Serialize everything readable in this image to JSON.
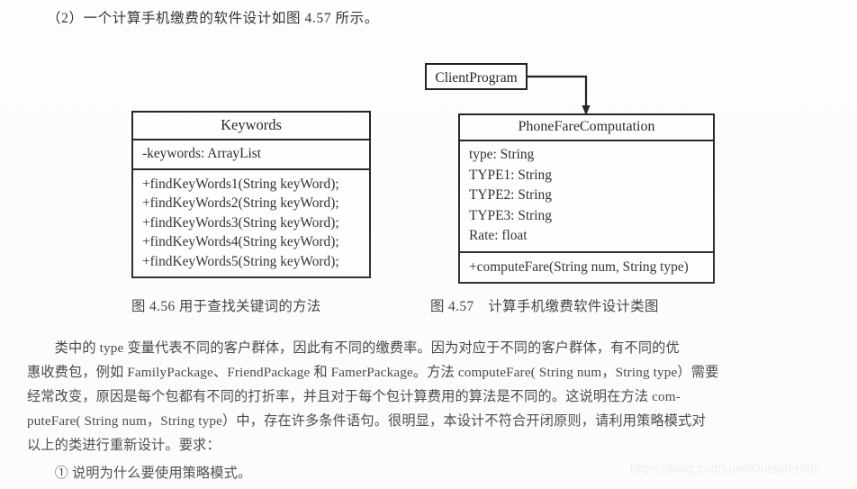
{
  "page": {
    "intro_text": "（2）一个计算手机缴费的软件设计如图 4.57 所示。",
    "watermark": "https://blog.csdn.net/Outsider98k"
  },
  "diagrams": {
    "keywords_class": {
      "name": "Keywords",
      "attributes": [
        "-keywords: ArrayList"
      ],
      "operations": [
        "+findKeyWords1(String keyWord);",
        "+findKeyWords2(String keyWord);",
        "+findKeyWords3(String keyWord);",
        "+findKeyWords4(String keyWord);",
        "+findKeyWords5(String keyWord);"
      ],
      "caption": "图 4.56 用于查找关键词的方法"
    },
    "client_program_class": {
      "name": "ClientProgram"
    },
    "phone_fare_class": {
      "name": "PhoneFareComputation",
      "attributes": [
        "type: String",
        "TYPE1: String",
        "TYPE2: String",
        "TYPE3: String",
        "Rate: float"
      ],
      "operations": [
        "+computeFare(String num, String type)"
      ],
      "caption": "图 4.57　计算手机缴费软件设计类图"
    },
    "connector": {
      "kind": "association-arrow",
      "from": "ClientProgram",
      "to": "PhoneFareComputation",
      "color": "#1c1c1c"
    }
  },
  "body": {
    "lines": [
      "　　类中的 type 变量代表不同的客户群体，因此有不同的缴费率。因为对应于不同的客户群体，有不同的优",
      "惠收费包，例如 FamilyPackage、FriendPackage 和 FamerPackage。方法 computeFare( String num，String type）需要",
      "经常改变，原因是每个包都有不同的打折率，并且对于每个包计算费用的算法是不同的。这说明在方法 com-",
      "puteFare( String num，String type）中，存在许多条件语句。很明显，本设计不符合开闭原则，请利用策略模式对",
      "以上的类进行重新设计。要求：",
      "　　① 说明为什么要使用策略模式。"
    ]
  },
  "colors": {
    "ink": "#1c1c1c",
    "text": "#2e2e2e",
    "paper": "#fdfdfd",
    "watermark": "#eeeeee"
  }
}
